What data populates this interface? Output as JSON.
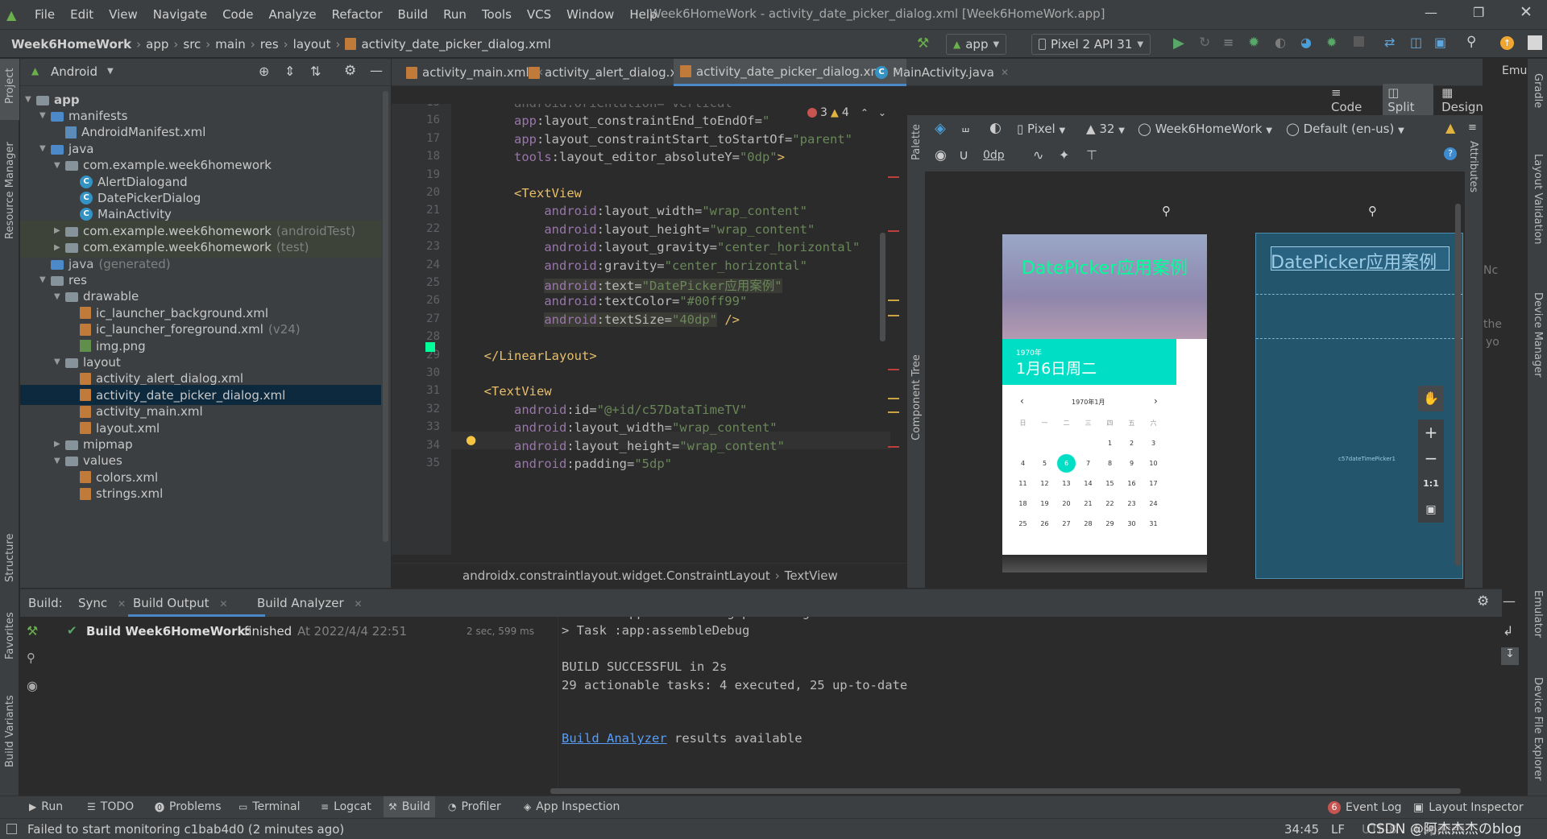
{
  "menu": {
    "items": [
      "File",
      "Edit",
      "View",
      "Navigate",
      "Code",
      "Analyze",
      "Refactor",
      "Build",
      "Run",
      "Tools",
      "VCS",
      "Window",
      "Help"
    ],
    "window_title": "Week6HomeWork - activity_date_picker_dialog.xml [Week6HomeWork.app]"
  },
  "breadcrumb": {
    "items": [
      "Week6HomeWork",
      "app",
      "src",
      "main",
      "res",
      "layout",
      "activity_date_picker_dialog.xml"
    ]
  },
  "toolbar": {
    "run_config": "app",
    "device": "Pixel 2 API 31"
  },
  "project": {
    "view": "Android",
    "tree": [
      {
        "label": "app",
        "depth": 0,
        "icon": "folder",
        "open": true,
        "bold": true
      },
      {
        "label": "manifests",
        "depth": 1,
        "icon": "folder-blue",
        "open": true
      },
      {
        "label": "AndroidManifest.xml",
        "depth": 2,
        "icon": "manifest"
      },
      {
        "label": "java",
        "depth": 1,
        "icon": "folder-blue",
        "open": true
      },
      {
        "label": "com.example.week6homework",
        "depth": 2,
        "icon": "folder",
        "open": true
      },
      {
        "label": "AlertDialogand",
        "depth": 3,
        "icon": "class"
      },
      {
        "label": "DatePickerDialog",
        "depth": 3,
        "icon": "class"
      },
      {
        "label": "MainActivity",
        "depth": 3,
        "icon": "class"
      },
      {
        "label": "com.example.week6homework",
        "suffix": "(androidTest)",
        "depth": 2,
        "icon": "folder",
        "open": false,
        "shade": true
      },
      {
        "label": "com.example.week6homework",
        "suffix": "(test)",
        "depth": 2,
        "icon": "folder",
        "open": false,
        "shade": true
      },
      {
        "label": "java",
        "suffix": "(generated)",
        "depth": 1,
        "icon": "folder-blue",
        "grey": true
      },
      {
        "label": "res",
        "depth": 1,
        "icon": "folder",
        "open": true
      },
      {
        "label": "drawable",
        "depth": 2,
        "icon": "folder",
        "open": true
      },
      {
        "label": "ic_launcher_background.xml",
        "depth": 3,
        "icon": "xml"
      },
      {
        "label": "ic_launcher_foreground.xml",
        "suffix": "(v24)",
        "depth": 3,
        "icon": "xml"
      },
      {
        "label": "img.png",
        "depth": 3,
        "icon": "png"
      },
      {
        "label": "layout",
        "depth": 2,
        "icon": "folder",
        "open": true
      },
      {
        "label": "activity_alert_dialog.xml",
        "depth": 3,
        "icon": "xml"
      },
      {
        "label": "activity_date_picker_dialog.xml",
        "depth": 3,
        "icon": "xml",
        "selected": true
      },
      {
        "label": "activity_main.xml",
        "depth": 3,
        "icon": "xml"
      },
      {
        "label": "layout.xml",
        "depth": 3,
        "icon": "xml"
      },
      {
        "label": "mipmap",
        "depth": 2,
        "icon": "folder",
        "open": false
      },
      {
        "label": "values",
        "depth": 2,
        "icon": "folder",
        "open": true
      },
      {
        "label": "colors.xml",
        "depth": 3,
        "icon": "xml"
      },
      {
        "label": "strings.xml",
        "depth": 3,
        "icon": "xml"
      }
    ]
  },
  "editor": {
    "tabs": [
      "activity_main.xml",
      "activity_alert_dialog.xml",
      "activity_date_picker_dialog.xml",
      "MainActivity.java"
    ],
    "active_tab": 2,
    "mode": {
      "code": "Code",
      "split": "Split",
      "design": "Design"
    },
    "inspections": {
      "errors": "3",
      "warnings": "4"
    },
    "lines": [
      {
        "n": "15",
        "tokens": [
          [
            "      android:orientation=\"vertical\"",
            "pun"
          ]
        ]
      },
      {
        "n": "16",
        "tokens": [
          [
            "      ",
            "pun"
          ],
          [
            "app",
            "ns"
          ],
          [
            ":layout_constraintEnd_toEndOf=",
            "at"
          ],
          [
            "\"",
            "str"
          ]
        ]
      },
      {
        "n": "17",
        "tokens": [
          [
            "      ",
            "pun"
          ],
          [
            "app",
            "ns"
          ],
          [
            ":layout_constraintStart_toStartOf=",
            "at"
          ],
          [
            "\"parent\"",
            "str"
          ]
        ]
      },
      {
        "n": "18",
        "tokens": [
          [
            "      ",
            "pun"
          ],
          [
            "tools",
            "ns"
          ],
          [
            ":layout_editor_absoluteY=",
            "at"
          ],
          [
            "\"0dp\"",
            "str"
          ],
          [
            ">",
            "tag"
          ]
        ]
      },
      {
        "n": "19",
        "tokens": []
      },
      {
        "n": "20",
        "tokens": [
          [
            "      ",
            "pun"
          ],
          [
            "<TextView",
            "tag"
          ]
        ]
      },
      {
        "n": "21",
        "tokens": [
          [
            "          ",
            "pun"
          ],
          [
            "android",
            "ns"
          ],
          [
            ":layout_width=",
            "at"
          ],
          [
            "\"wrap_content\"",
            "str"
          ]
        ]
      },
      {
        "n": "22",
        "tokens": [
          [
            "          ",
            "pun"
          ],
          [
            "android",
            "ns"
          ],
          [
            ":layout_height=",
            "at"
          ],
          [
            "\"wrap_content\"",
            "str"
          ]
        ]
      },
      {
        "n": "23",
        "tokens": [
          [
            "          ",
            "pun"
          ],
          [
            "android",
            "ns"
          ],
          [
            ":layout_gravity=",
            "at"
          ],
          [
            "\"center_horizontal\"",
            "str"
          ]
        ]
      },
      {
        "n": "24",
        "tokens": [
          [
            "          ",
            "pun"
          ],
          [
            "android",
            "ns"
          ],
          [
            ":gravity=",
            "at"
          ],
          [
            "\"center_horizontal\"",
            "str"
          ]
        ]
      },
      {
        "n": "25",
        "tokens": [
          [
            "          ",
            "pun"
          ],
          [
            "android",
            "ns"
          ],
          [
            ":text=",
            "at"
          ],
          [
            "\"DatePicker应用案例\"",
            "str"
          ]
        ]
      },
      {
        "n": "26",
        "tokens": [
          [
            "          ",
            "pun"
          ],
          [
            "android",
            "ns"
          ],
          [
            ":textColor=",
            "at"
          ],
          [
            "\"#00ff99\"",
            "str"
          ]
        ]
      },
      {
        "n": "27",
        "tokens": [
          [
            "          ",
            "pun"
          ],
          [
            "android",
            "ns"
          ],
          [
            ":textSize=",
            "at"
          ],
          [
            "\"40dp\"",
            "str"
          ],
          [
            " />",
            "tag"
          ]
        ]
      },
      {
        "n": "28",
        "tokens": []
      },
      {
        "n": "29",
        "tokens": [
          [
            "  ",
            "pun"
          ],
          [
            "</LinearLayout>",
            "tag"
          ]
        ]
      },
      {
        "n": "30",
        "tokens": []
      },
      {
        "n": "31",
        "tokens": [
          [
            "  ",
            "pun"
          ],
          [
            "<TextView",
            "tag"
          ]
        ]
      },
      {
        "n": "32",
        "tokens": [
          [
            "      ",
            "pun"
          ],
          [
            "android",
            "ns"
          ],
          [
            ":id=",
            "at"
          ],
          [
            "\"@+id/c57DataTimeTV\"",
            "str"
          ]
        ]
      },
      {
        "n": "33",
        "tokens": [
          [
            "      ",
            "pun"
          ],
          [
            "android",
            "ns"
          ],
          [
            ":layout_width=",
            "at"
          ],
          [
            "\"wrap_content\"",
            "str"
          ]
        ]
      },
      {
        "n": "34",
        "tokens": [
          [
            "      ",
            "pun"
          ],
          [
            "android",
            "ns"
          ],
          [
            ":layout_height=",
            "at"
          ],
          [
            "\"wrap_content\"",
            "str"
          ]
        ]
      },
      {
        "n": "35",
        "tokens": [
          [
            "      ",
            "pun"
          ],
          [
            "android",
            "ns"
          ],
          [
            ":padding=",
            "at"
          ],
          [
            "\"5dp\"",
            "str"
          ]
        ]
      }
    ],
    "breadcrumb": [
      "androidx.constraintlayout.widget.ConstraintLayout",
      "TextView"
    ]
  },
  "design": {
    "device": "Pixel",
    "api": "32",
    "theme": "Week6HomeWork",
    "locale": "Default (en-us)",
    "margin": "0dp",
    "preview_title": "DatePicker应用案例",
    "year": "1970年",
    "date": "1月6日周二",
    "month_label": "1970年1月",
    "blueprint_label": "c57dateTimePicker1",
    "weekdays": [
      "日",
      "一",
      "二",
      "三",
      "四",
      "五",
      "六"
    ],
    "weeks": [
      [
        "",
        "",
        "",
        "",
        "1",
        "2",
        "3"
      ],
      [
        "4",
        "5",
        "6",
        "7",
        "8",
        "9",
        "10"
      ],
      [
        "11",
        "12",
        "13",
        "14",
        "15",
        "16",
        "17"
      ],
      [
        "18",
        "19",
        "20",
        "21",
        "22",
        "23",
        "24"
      ],
      [
        "25",
        "26",
        "27",
        "28",
        "29",
        "30",
        "31"
      ]
    ],
    "selected_day": "6",
    "side_labels": {
      "palette": "Palette",
      "component_tree": "Component Tree",
      "attributes": "Attributes"
    },
    "zoom_fit": "1:1",
    "partial_a": "Nc",
    "partial_b": "the",
    "partial_c": "yo"
  },
  "build": {
    "label": "Build:",
    "tabs": [
      "Sync",
      "Build Output",
      "Build Analyzer"
    ],
    "status_bold": "Build Week6HomeWork:",
    "status": "finished",
    "time": "At 2022/4/4 22:51",
    "duration": "2 sec, 599 ms",
    "console": [
      "> Task :app:createDebugApkListingFileRedirect UP-TO-DATE",
      "> Task :app:assembleDebug",
      "",
      "BUILD SUCCESSFUL in 2s",
      "29 actionable tasks: 4 executed, 25 up-to-date",
      ""
    ],
    "analyzer_link": "Build Analyzer",
    "analyzer_tail": " results available"
  },
  "bottom_tabs": [
    "Run",
    "TODO",
    "Problems",
    "Terminal",
    "Logcat",
    "Build",
    "Profiler",
    "App Inspection"
  ],
  "event_log": {
    "count": "6",
    "label": "Event Log"
  },
  "layout_inspector": "Layout Inspector",
  "status": {
    "message": "Failed to start monitoring c1bab4d0 (2 minutes ago)",
    "position": "34:45",
    "line_sep": "LF",
    "encoding": "UTF-8",
    "indent": "4 spaces",
    "watermark": "CSDN @阿杰杰杰のblog"
  },
  "left_strip": [
    "Project",
    "Resource Manager",
    "Structure",
    "Favorites",
    "Build Variants"
  ],
  "right_strip": [
    "Gradle",
    "Layout Validation",
    "Device Manager",
    "Emulator",
    "Device File Explorer"
  ],
  "right_top": "Emu"
}
